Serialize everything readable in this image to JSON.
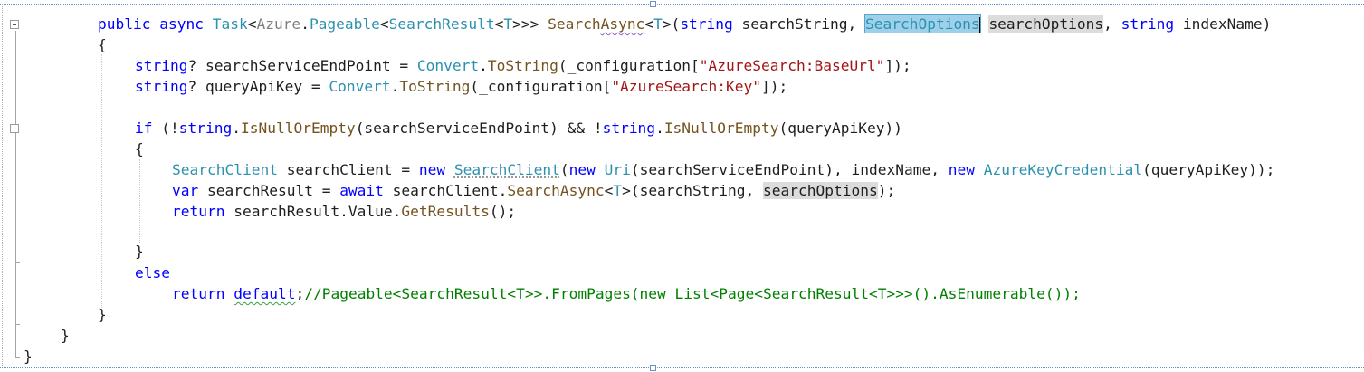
{
  "editor": {
    "lines": [
      {
        "indent": 108,
        "tokens": [
          {
            "t": "public",
            "c": "kw"
          },
          {
            "t": " ",
            "c": "pl"
          },
          {
            "t": "async",
            "c": "kw"
          },
          {
            "t": " ",
            "c": "pl"
          },
          {
            "t": "Task",
            "c": "ty"
          },
          {
            "t": "<",
            "c": "pl"
          },
          {
            "t": "Azure",
            "c": "gr"
          },
          {
            "t": ".",
            "c": "pl"
          },
          {
            "t": "Pageable",
            "c": "ty"
          },
          {
            "t": "<",
            "c": "pl"
          },
          {
            "t": "SearchResult",
            "c": "ty"
          },
          {
            "t": "<",
            "c": "pl"
          },
          {
            "t": "T",
            "c": "ty"
          },
          {
            "t": ">>> ",
            "c": "pl"
          },
          {
            "t": "Search",
            "c": "mt"
          },
          {
            "t": "Async",
            "c": "mt squig-p"
          },
          {
            "t": "<",
            "c": "pl"
          },
          {
            "t": "T",
            "c": "ty"
          },
          {
            "t": ">(",
            "c": "pl"
          },
          {
            "t": "string",
            "c": "kw"
          },
          {
            "t": " searchString, ",
            "c": "pl"
          },
          {
            "t": "SearchOptions",
            "c": "ty sel",
            "caret": true
          },
          {
            "t": " ",
            "c": "pl"
          },
          {
            "t": "searchOptions",
            "c": "pl ref"
          },
          {
            "t": ", ",
            "c": "pl"
          },
          {
            "t": "string",
            "c": "kw"
          },
          {
            "t": " indexName)",
            "c": "pl"
          }
        ]
      },
      {
        "indent": 108,
        "tokens": [
          {
            "t": "{",
            "c": "pl"
          }
        ]
      },
      {
        "indent": 149,
        "tokens": [
          {
            "t": "string",
            "c": "kw"
          },
          {
            "t": "? searchServiceEndPoint = ",
            "c": "pl"
          },
          {
            "t": "Convert",
            "c": "ty"
          },
          {
            "t": ".",
            "c": "pl"
          },
          {
            "t": "ToString",
            "c": "mt"
          },
          {
            "t": "(_configuration[",
            "c": "pl"
          },
          {
            "t": "\"AzureSearch:BaseUrl\"",
            "c": "st"
          },
          {
            "t": "]);",
            "c": "pl"
          }
        ]
      },
      {
        "indent": 149,
        "tokens": [
          {
            "t": "string",
            "c": "kw"
          },
          {
            "t": "? queryApiKey = ",
            "c": "pl"
          },
          {
            "t": "Convert",
            "c": "ty"
          },
          {
            "t": ".",
            "c": "pl"
          },
          {
            "t": "ToString",
            "c": "mt"
          },
          {
            "t": "(_configuration[",
            "c": "pl"
          },
          {
            "t": "\"AzureSearch:Key\"",
            "c": "st"
          },
          {
            "t": "]);",
            "c": "pl"
          }
        ]
      },
      {
        "indent": 149,
        "tokens": []
      },
      {
        "indent": 149,
        "tokens": [
          {
            "t": "if",
            "c": "kw"
          },
          {
            "t": " (!",
            "c": "pl"
          },
          {
            "t": "string",
            "c": "kw"
          },
          {
            "t": ".",
            "c": "pl"
          },
          {
            "t": "IsNullOrEmpty",
            "c": "mt"
          },
          {
            "t": "(searchServiceEndPoint) && !",
            "c": "pl"
          },
          {
            "t": "string",
            "c": "kw"
          },
          {
            "t": ".",
            "c": "pl"
          },
          {
            "t": "IsNullOrEmpty",
            "c": "mt"
          },
          {
            "t": "(queryApiKey))",
            "c": "pl"
          }
        ]
      },
      {
        "indent": 149,
        "tokens": [
          {
            "t": "{",
            "c": "pl"
          }
        ]
      },
      {
        "indent": 190,
        "tokens": [
          {
            "t": "SearchClient",
            "c": "ty"
          },
          {
            "t": " searchClient = ",
            "c": "pl"
          },
          {
            "t": "new",
            "c": "kw"
          },
          {
            "t": " ",
            "c": "pl"
          },
          {
            "t": "SearchClient",
            "c": "ty dots"
          },
          {
            "t": "(",
            "c": "pl"
          },
          {
            "t": "new",
            "c": "kw"
          },
          {
            "t": " ",
            "c": "pl"
          },
          {
            "t": "Uri",
            "c": "ty"
          },
          {
            "t": "(searchServiceEndPoint), indexName, ",
            "c": "pl"
          },
          {
            "t": "new",
            "c": "kw"
          },
          {
            "t": " ",
            "c": "pl"
          },
          {
            "t": "AzureKeyCredential",
            "c": "ty"
          },
          {
            "t": "(queryApiKey));",
            "c": "pl"
          }
        ]
      },
      {
        "indent": 190,
        "tokens": [
          {
            "t": "var",
            "c": "kw"
          },
          {
            "t": " searchResult = ",
            "c": "pl"
          },
          {
            "t": "await",
            "c": "kw"
          },
          {
            "t": " searchClient.",
            "c": "pl"
          },
          {
            "t": "SearchAsync",
            "c": "mt"
          },
          {
            "t": "<",
            "c": "pl"
          },
          {
            "t": "T",
            "c": "ty"
          },
          {
            "t": ">(searchString, ",
            "c": "pl"
          },
          {
            "t": "searchOptions",
            "c": "pl ref"
          },
          {
            "t": ");",
            "c": "pl"
          }
        ]
      },
      {
        "indent": 190,
        "tokens": [
          {
            "t": "return",
            "c": "kw"
          },
          {
            "t": " searchResult.Value.",
            "c": "pl"
          },
          {
            "t": "GetResults",
            "c": "mt"
          },
          {
            "t": "();",
            "c": "pl"
          }
        ]
      },
      {
        "indent": 190,
        "tokens": []
      },
      {
        "indent": 149,
        "tokens": [
          {
            "t": "}",
            "c": "pl"
          }
        ]
      },
      {
        "indent": 149,
        "tokens": [
          {
            "t": "else",
            "c": "kw"
          }
        ]
      },
      {
        "indent": 190,
        "tokens": [
          {
            "t": "return",
            "c": "kw"
          },
          {
            "t": " ",
            "c": "pl"
          },
          {
            "t": "default",
            "c": "kw squig-g"
          },
          {
            "t": ";",
            "c": "pl"
          },
          {
            "t": "//Pageable<SearchResult<T>>.FromPages(new List<Page<SearchResult<T>>>().AsEnumerable());",
            "c": "cm"
          }
        ]
      },
      {
        "indent": 108,
        "tokens": [
          {
            "t": "}",
            "c": "pl"
          }
        ]
      },
      {
        "indent": 67,
        "tokens": [
          {
            "t": "}",
            "c": "pl"
          }
        ]
      },
      {
        "indent": 26,
        "tokens": [
          {
            "t": "}",
            "c": "pl"
          }
        ]
      }
    ]
  }
}
